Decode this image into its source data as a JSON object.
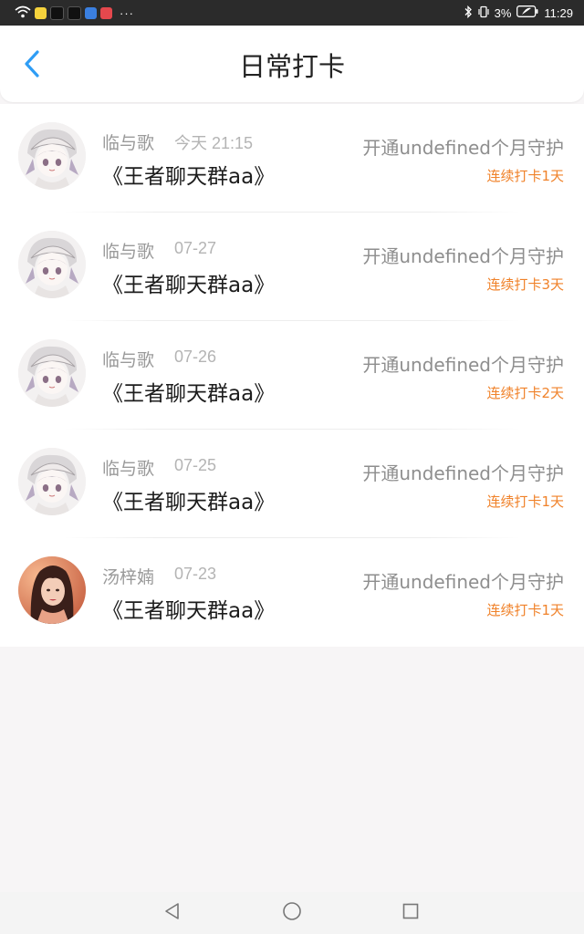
{
  "status_bar": {
    "battery_percent": "3%",
    "time": "11:29",
    "more_glyph": "···",
    "app_icon_colors": [
      "#f5d23c",
      "#111111",
      "#111111",
      "#3a7fe0",
      "#e5484d"
    ]
  },
  "header": {
    "title": "日常打卡",
    "back_icon": "chevron-left-icon",
    "accent_color": "#2f9df5"
  },
  "checkins": [
    {
      "user": "临与歌",
      "time": "今天 21:15",
      "group": "《王者聊天群aa》",
      "guard": "开通undefined个月守护",
      "streak": "连续打卡1天",
      "avatar": "anime-girl"
    },
    {
      "user": "临与歌",
      "time": "07-27",
      "group": "《王者聊天群aa》",
      "guard": "开通undefined个月守护",
      "streak": "连续打卡3天",
      "avatar": "anime-girl"
    },
    {
      "user": "临与歌",
      "time": "07-26",
      "group": "《王者聊天群aa》",
      "guard": "开通undefined个月守护",
      "streak": "连续打卡2天",
      "avatar": "anime-girl"
    },
    {
      "user": "临与歌",
      "time": "07-25",
      "group": "《王者聊天群aa》",
      "guard": "开通undefined个月守护",
      "streak": "连续打卡1天",
      "avatar": "anime-girl"
    },
    {
      "user": "汤梓婻",
      "time": "07-23",
      "group": "《王者聊天群aa》",
      "guard": "开通undefined个月守护",
      "streak": "连续打卡1天",
      "avatar": "photo-woman"
    }
  ],
  "colors": {
    "streak": "#f0822a",
    "background": "#f7f5f6"
  },
  "nav_bar": {
    "back_icon": "triangle-back-icon",
    "home_icon": "circle-home-icon",
    "recents_icon": "square-recents-icon"
  }
}
